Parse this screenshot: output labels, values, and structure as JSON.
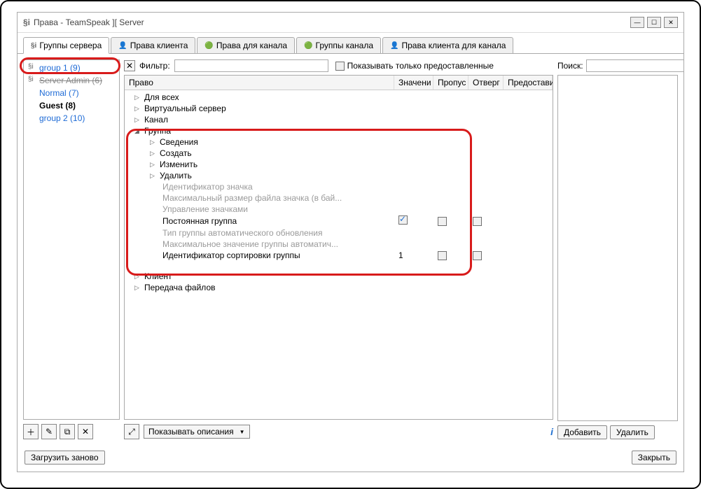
{
  "window": {
    "title": "Права - TeamSpeak ][ Server"
  },
  "tabs": [
    {
      "label": "Группы сервера",
      "active": true
    },
    {
      "label": "Права клиента"
    },
    {
      "label": "Права для канала"
    },
    {
      "label": "Группы канала"
    },
    {
      "label": "Права клиента для канала"
    }
  ],
  "groups": {
    "items": [
      {
        "label": "group 1 (9)",
        "highlighted": true
      },
      {
        "label": "Server Admin (6)",
        "obscured": true
      },
      {
        "label": "Normal (7)"
      },
      {
        "label": "Guest (8)",
        "bold": true
      },
      {
        "label": "group 2 (10)"
      }
    ]
  },
  "filter": {
    "label": "Фильтр:",
    "show_granted_only": "Показывать только предоставленные"
  },
  "columns": {
    "c1": "Право",
    "c2": "Значени",
    "c3": "Пропус",
    "c4": "Отверг",
    "c5": "Предостави"
  },
  "tree": {
    "for_all": "Для всех",
    "virtual_server": "Виртуальный сервер",
    "channel": "Канал",
    "group": "Группа",
    "info": "Сведения",
    "create": "Создать",
    "modify": "Изменить",
    "delete": "Удалить",
    "icon_id": "Идентификатор значка",
    "max_icon_size": "Максимальный размер файла значка (в бай...",
    "icon_manage": "Управление значками",
    "permanent_group": "Постоянная группа",
    "auto_update_type": "Тип группы автоматического обновления",
    "auto_update_max": "Максимальное значение группы автоматич...",
    "sort_id": "Идентификатор сортировки группы",
    "sort_id_value": "1",
    "client": "Клиент",
    "file_transfer": "Передача файлов"
  },
  "center_bottom": {
    "show_descriptions": "Показывать описания"
  },
  "search": {
    "label": "Поиск:"
  },
  "buttons": {
    "add": "Добавить",
    "delete": "Удалить",
    "reload": "Загрузить заново",
    "close": "Закрыть"
  }
}
